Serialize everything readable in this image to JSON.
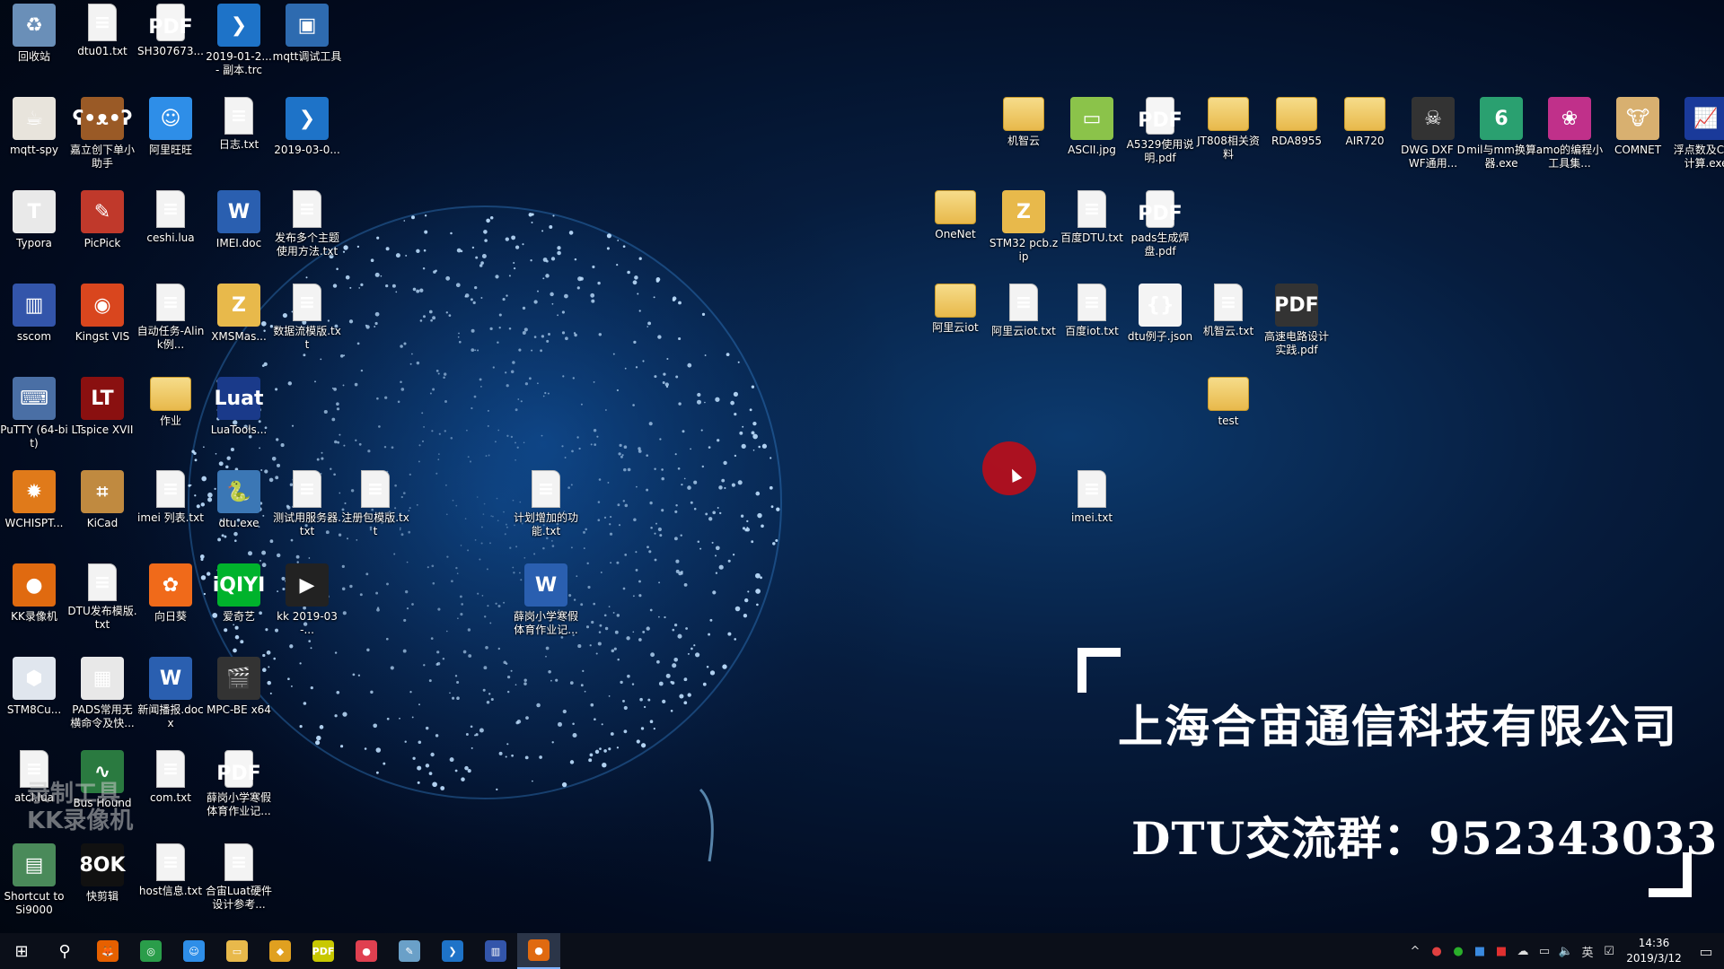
{
  "desktop_icons_left": [
    {
      "label": "回收站",
      "icon": "recycle-bin-icon",
      "glyph": "♻",
      "color": "#6a8fb8"
    },
    {
      "label": "dtu01.txt",
      "icon": "text-file-icon",
      "glyph": "≡",
      "color": "txt"
    },
    {
      "label": "SH307673...",
      "icon": "pdf-file-icon",
      "glyph": "PDF",
      "color": "pdf"
    },
    {
      "label": "2019-01-2... - 副本.trc",
      "icon": "vscode-icon",
      "glyph": "❯",
      "color": "#1e73c8"
    },
    {
      "label": "mqtt调试工具",
      "icon": "app-window-icon",
      "glyph": "▣",
      "color": "#2e6bb0"
    },
    {
      "label": "mqtt-spy",
      "icon": "java-icon",
      "glyph": "☕",
      "color": "#e8e4dc"
    },
    {
      "label": "嘉立创下单小助手",
      "icon": "bear-icon",
      "glyph": "ʕ•ᴥ•ʔ",
      "color": "#9a5a26"
    },
    {
      "label": "阿里旺旺",
      "icon": "wangwang-icon",
      "glyph": "☺",
      "color": "#2e8ee8"
    },
    {
      "label": "日志.txt",
      "icon": "text-file-icon",
      "glyph": "≡",
      "color": "txt"
    },
    {
      "label": "2019-03-0...",
      "icon": "vscode-icon",
      "glyph": "❯",
      "color": "#1e73c8"
    },
    {
      "label": "Typora",
      "icon": "typora-icon",
      "glyph": "T",
      "color": "#e9e9e9"
    },
    {
      "label": "PicPick",
      "icon": "picpick-icon",
      "glyph": "✎",
      "color": "#c0392b"
    },
    {
      "label": "ceshi.lua",
      "icon": "text-file-icon",
      "glyph": "≡",
      "color": "txt"
    },
    {
      "label": "IMEI.doc",
      "icon": "word-doc-icon",
      "glyph": "W",
      "color": "#2a5fb0"
    },
    {
      "label": "发布多个主题使用方法.txt",
      "icon": "text-file-icon",
      "glyph": "≡",
      "color": "txt"
    },
    {
      "label": "sscom",
      "icon": "sscom-icon",
      "glyph": "▥",
      "color": "#3355aa"
    },
    {
      "label": "Kingst VIS",
      "icon": "kingst-icon",
      "glyph": "◉",
      "color": "#d9461e"
    },
    {
      "label": "自动任务-Alink例...",
      "icon": "text-file-icon",
      "glyph": "≡",
      "color": "txt"
    },
    {
      "label": "XMSMas...",
      "icon": "zip-folder-icon",
      "glyph": "Z",
      "color": "#e8b94b"
    },
    {
      "label": "数据流模版.txt",
      "icon": "text-file-icon",
      "glyph": "≡",
      "color": "txt"
    },
    {
      "label": "PuTTY (64-bit)",
      "icon": "putty-icon",
      "glyph": "⌨",
      "color": "#4a6fa5"
    },
    {
      "label": "LTspice XVII",
      "icon": "ltspice-icon",
      "glyph": "LT",
      "color": "#8a1010"
    },
    {
      "label": "作业",
      "icon": "folder-icon",
      "glyph": "",
      "color": "folder"
    },
    {
      "label": "LuaTools...",
      "icon": "luat-icon",
      "glyph": "Luat",
      "color": "#1a3a8a"
    },
    {
      "label": "WCHISPT...",
      "icon": "gear-icon",
      "glyph": "✹",
      "color": "#e07a1a"
    },
    {
      "label": "KiCad",
      "icon": "kicad-icon",
      "glyph": "⌗",
      "color": "#c08a40"
    },
    {
      "label": "imei 列表.txt",
      "icon": "text-file-icon",
      "glyph": "≡",
      "color": "txt"
    },
    {
      "label": "dtu.exe",
      "icon": "python-exe-icon",
      "glyph": "🐍",
      "color": "#3b77b5"
    },
    {
      "label": "测试用服务器.txt",
      "icon": "text-file-icon",
      "glyph": "≡",
      "color": "txt"
    },
    {
      "label": "注册包模版.txt",
      "icon": "text-file-icon",
      "glyph": "≡",
      "color": "txt"
    },
    {
      "label": "计划增加的功能.txt",
      "icon": "text-file-icon",
      "glyph": "≡",
      "color": "txt"
    },
    {
      "label": "KK录像机",
      "icon": "kk-recorder-icon",
      "glyph": "●",
      "color": "#e06a10"
    },
    {
      "label": "DTU发布模版.txt",
      "icon": "text-file-icon",
      "glyph": "≡",
      "color": "txt"
    },
    {
      "label": "向日葵",
      "icon": "sunflower-icon",
      "glyph": "✿",
      "color": "#f06a1a"
    },
    {
      "label": "爱奇艺",
      "icon": "iqiyi-icon",
      "glyph": "iQIYI",
      "color": "#00b32c"
    },
    {
      "label": "kk 2019-03-...",
      "icon": "video-file-icon",
      "glyph": "▶",
      "color": "#222"
    },
    {
      "label": "薛岗小学寒假体育作业记...",
      "icon": "word-doc-icon",
      "glyph": "W",
      "color": "#2a5fb0"
    },
    {
      "label": "STM8Cu...",
      "icon": "stm8-icon",
      "glyph": "⬢",
      "color": "#e0e6ee"
    },
    {
      "label": "PADS常用无横命令及快...",
      "icon": "pads-icon",
      "glyph": "▦",
      "color": "#e8e8e8"
    },
    {
      "label": "新闻播报.docx",
      "icon": "word-doc-icon",
      "glyph": "W",
      "color": "#2a5fb0"
    },
    {
      "label": "MPC-BE x64",
      "icon": "mpc-icon",
      "glyph": "🎬",
      "color": "#333"
    },
    {
      "label": "atcl.lua",
      "icon": "text-file-icon",
      "glyph": "≡",
      "color": "txt"
    },
    {
      "label": "Bus Hound",
      "icon": "bus-hound-icon",
      "glyph": "∿",
      "color": "#2a7a40"
    },
    {
      "label": "com.txt",
      "icon": "text-file-icon",
      "glyph": "≡",
      "color": "txt"
    },
    {
      "label": "薛岗小学寒假体育作业记...",
      "icon": "pdf-file-icon",
      "glyph": "PDF",
      "color": "pdf"
    },
    {
      "label": "Shortcut to Si9000",
      "icon": "si9000-icon",
      "glyph": "▤",
      "color": "#4a8a5a"
    },
    {
      "label": "快剪辑",
      "icon": "kuaijianji-icon",
      "glyph": "8OK",
      "color": "#111"
    },
    {
      "label": "host信息.txt",
      "icon": "text-file-icon",
      "glyph": "≡",
      "color": "txt"
    },
    {
      "label": "合宙Luat硬件设计参考...",
      "icon": "text-file-icon",
      "glyph": "≡",
      "color": "txt"
    }
  ],
  "desktop_icons_right": [
    {
      "label": "机智云",
      "icon": "folder-icon",
      "glyph": "",
      "color": "folder"
    },
    {
      "label": "ASCII.jpg",
      "icon": "image-file-icon",
      "glyph": "▭",
      "color": "#8bc34a"
    },
    {
      "label": "A5329使用说明.pdf",
      "icon": "pdf-file-icon",
      "glyph": "PDF",
      "color": "pdf"
    },
    {
      "label": "JT808相关资料",
      "icon": "folder-icon",
      "glyph": "",
      "color": "folder"
    },
    {
      "label": "RDA8955",
      "icon": "folder-icon",
      "glyph": "",
      "color": "folder"
    },
    {
      "label": "AIR720",
      "icon": "folder-icon",
      "glyph": "",
      "color": "folder"
    },
    {
      "label": "DWG DXF DWF通用...",
      "icon": "skull-icon",
      "glyph": "☠",
      "color": "#333"
    },
    {
      "label": "mil与mm换算器.exe",
      "icon": "converter-icon",
      "glyph": "6",
      "color": "#2aa070"
    },
    {
      "label": "amo的编程小工具集...",
      "icon": "flower-icon",
      "glyph": "❀",
      "color": "#c0308a"
    },
    {
      "label": "COMNET",
      "icon": "cow-icon",
      "glyph": "🐮",
      "color": "#d8b070"
    },
    {
      "label": "浮点数及CRC计算.exe",
      "icon": "chart-icon",
      "glyph": "📈",
      "color": "#1a3a9a"
    },
    {
      "label": "OneNet",
      "icon": "folder-icon",
      "glyph": "",
      "color": "folder"
    },
    {
      "label": "STM32 pcb.zip",
      "icon": "zip-folder-icon",
      "glyph": "Z",
      "color": "#e8b94b"
    },
    {
      "label": "百度DTU.txt",
      "icon": "text-file-icon",
      "glyph": "≡",
      "color": "txt"
    },
    {
      "label": "pads生成焊盘.pdf",
      "icon": "pdf-file-icon",
      "glyph": "PDF",
      "color": "pdf"
    },
    {
      "label": "阿里云iot",
      "icon": "folder-icon",
      "glyph": "",
      "color": "folder"
    },
    {
      "label": "阿里云iot.txt",
      "icon": "text-file-icon",
      "glyph": "≡",
      "color": "txt"
    },
    {
      "label": "百度iot.txt",
      "icon": "text-file-icon",
      "glyph": "≡",
      "color": "txt"
    },
    {
      "label": "dtu例子.json",
      "icon": "json-file-icon",
      "glyph": "{}",
      "color": "#f4f4f4"
    },
    {
      "label": "机智云.txt",
      "icon": "text-file-icon",
      "glyph": "≡",
      "color": "txt"
    },
    {
      "label": "高速电路设计实践.pdf",
      "icon": "pdf-file-icon",
      "glyph": "PDF",
      "color": "#333"
    },
    {
      "label": "test",
      "icon": "folder-icon",
      "glyph": "",
      "color": "folder"
    },
    {
      "label": "imei.txt",
      "icon": "text-file-icon",
      "glyph": "≡",
      "color": "txt"
    }
  ],
  "overlay": {
    "company": "上海合宙通信科技有限公司",
    "dtu_group": "DTU交流群：952343033",
    "kk_watermark": "录制工具\nKK录像机"
  },
  "taskbar": {
    "apps": [
      {
        "name": "start-button",
        "glyph": "⊞",
        "color": "#fff"
      },
      {
        "name": "search-button",
        "glyph": "⚲",
        "color": "#fff"
      },
      {
        "name": "firefox-taskbar-icon",
        "glyph": "🦊",
        "color": "#e66000"
      },
      {
        "name": "chrome-taskbar-icon",
        "glyph": "◎",
        "color": "#2a9d4a"
      },
      {
        "name": "wangwang-taskbar-icon",
        "glyph": "☺",
        "color": "#2e8ee8"
      },
      {
        "name": "file-explorer-taskbar-icon",
        "glyph": "▭",
        "color": "#e8b94b"
      },
      {
        "name": "git-taskbar-icon",
        "glyph": "◆",
        "color": "#e0a020"
      },
      {
        "name": "pdf-reader-taskbar-icon",
        "glyph": "PDF",
        "color": "#c8c800"
      },
      {
        "name": "red-app-taskbar-icon",
        "glyph": "●",
        "color": "#e04050"
      },
      {
        "name": "notepad-taskbar-icon",
        "glyph": "✎",
        "color": "#6aa0c8"
      },
      {
        "name": "vscode-taskbar-icon",
        "glyph": "❯",
        "color": "#1e73c8"
      },
      {
        "name": "sscom-taskbar-icon",
        "glyph": "▥",
        "color": "#3355aa"
      },
      {
        "name": "kk-recorder-taskbar-icon",
        "glyph": "●",
        "color": "#e06a10",
        "active": true
      }
    ],
    "tray": {
      "show_hidden": "^",
      "ime": "英",
      "time": "14:36",
      "date": "2019/3/12"
    }
  }
}
